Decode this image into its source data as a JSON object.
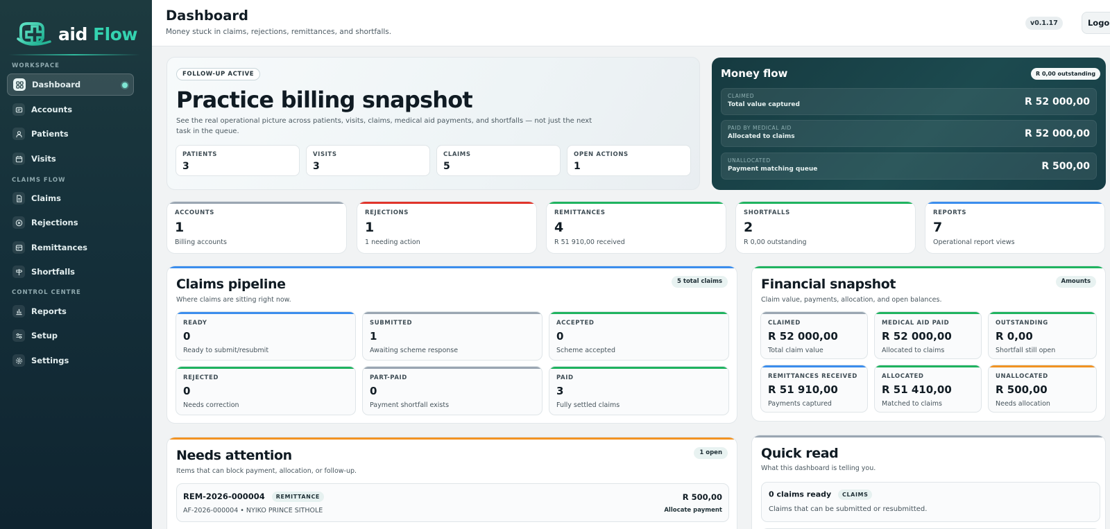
{
  "brand": {
    "word1": "aid",
    "word2": "Flow"
  },
  "sidebar": {
    "sections": {
      "workspace": "WORKSPACE",
      "claims_flow": "CLAIMS FLOW",
      "control_centre": "CONTROL CENTRE"
    },
    "items": [
      {
        "label": "Dashboard",
        "icon": "grid-icon",
        "active": true
      },
      {
        "label": "Accounts",
        "icon": "wallet-icon"
      },
      {
        "label": "Patients",
        "icon": "user-icon"
      },
      {
        "label": "Visits",
        "icon": "calendar-icon"
      },
      {
        "label": "Claims",
        "icon": "document-icon"
      },
      {
        "label": "Rejections",
        "icon": "x-circle-icon"
      },
      {
        "label": "Remittances",
        "icon": "receipt-icon"
      },
      {
        "label": "Shortfalls",
        "icon": "signpost-icon"
      },
      {
        "label": "Reports",
        "icon": "bar-chart-icon"
      },
      {
        "label": "Setup",
        "icon": "sliders-icon"
      },
      {
        "label": "Settings",
        "icon": "gear-icon"
      }
    ]
  },
  "header": {
    "title": "Dashboard",
    "subtitle": "Money stuck in claims, rejections, remittances, and shortfalls.",
    "version": "v0.1.17",
    "logout": "Logout"
  },
  "hero": {
    "badge": "FOLLOW-UP ACTIVE",
    "title": "Practice billing snapshot",
    "description": "See the real operational picture across patients, visits, claims, medical aid payments, and shortfalls — not just the next task in the queue.",
    "metrics": [
      {
        "label": "PATIENTS",
        "value": "3"
      },
      {
        "label": "VISITS",
        "value": "3"
      },
      {
        "label": "CLAIMS",
        "value": "5"
      },
      {
        "label": "OPEN ACTIONS",
        "value": "1"
      }
    ]
  },
  "money_flow": {
    "title": "Money flow",
    "outstanding": "R 0,00 outstanding",
    "rows": [
      {
        "label": "CLAIMED",
        "sub": "Total value captured",
        "value": "R 52 000,00"
      },
      {
        "label": "PAID BY MEDICAL AID",
        "sub": "Allocated to claims",
        "value": "R 52 000,00"
      },
      {
        "label": "UNALLOCATED",
        "sub": "Payment matching queue",
        "value": "R 500,00"
      }
    ]
  },
  "stats": [
    {
      "label": "ACCOUNTS",
      "value": "1",
      "sub": "Billing accounts",
      "color": "#9aa6b2"
    },
    {
      "label": "REJECTIONS",
      "value": "1",
      "sub": "1 needing action",
      "color": "#e0342b"
    },
    {
      "label": "REMITTANCES",
      "value": "4",
      "sub": "R 51 910,00 received",
      "color": "#1fb35f"
    },
    {
      "label": "SHORTFALLS",
      "value": "2",
      "sub": "R 0,00 outstanding",
      "color": "#1fb35f"
    },
    {
      "label": "REPORTS",
      "value": "7",
      "sub": "Operational report views",
      "color": "#3b8ded"
    }
  ],
  "pipeline": {
    "title": "Claims pipeline",
    "subtitle": "Where claims are sitting right now.",
    "badge": "5 total claims",
    "tiles": [
      {
        "label": "READY",
        "value": "0",
        "sub": "Ready to submit/resubmit",
        "color": "#3b8ded"
      },
      {
        "label": "SUBMITTED",
        "value": "1",
        "sub": "Awaiting scheme response",
        "color": "#9aa6b2"
      },
      {
        "label": "ACCEPTED",
        "value": "0",
        "sub": "Scheme accepted",
        "color": "#1fb35f"
      },
      {
        "label": "REJECTED",
        "value": "0",
        "sub": "Needs correction",
        "color": "#1fb35f"
      },
      {
        "label": "PART-PAID",
        "value": "0",
        "sub": "Payment shortfall exists",
        "color": "#9aa6b2"
      },
      {
        "label": "PAID",
        "value": "3",
        "sub": "Fully settled claims",
        "color": "#1fb35f"
      }
    ]
  },
  "financial": {
    "title": "Financial snapshot",
    "subtitle": "Claim value, payments, allocation, and open balances.",
    "badge": "Amounts",
    "tiles": [
      {
        "label": "CLAIMED",
        "value": "R 52 000,00",
        "sub": "Total claim value",
        "color": "#9aa6b2"
      },
      {
        "label": "MEDICAL AID PAID",
        "value": "R 52 000,00",
        "sub": "Allocated to claims",
        "color": "#1fb35f"
      },
      {
        "label": "OUTSTANDING",
        "value": "R 0,00",
        "sub": "Shortfall still open",
        "color": "#1fb35f"
      },
      {
        "label": "REMITTANCES RECEIVED",
        "value": "R 51 910,00",
        "sub": "Payments captured",
        "color": "#3b8ded"
      },
      {
        "label": "ALLOCATED",
        "value": "R 51 410,00",
        "sub": "Matched to claims",
        "color": "#1fb35f"
      },
      {
        "label": "UNALLOCATED",
        "value": "R 500,00",
        "sub": "Needs allocation",
        "color": "#f29322"
      }
    ]
  },
  "attention": {
    "title": "Needs attention",
    "subtitle": "Items that can block payment, allocation, or follow-up.",
    "badge": "1 open",
    "items": [
      {
        "ref": "REM-2026-000004",
        "tag": "REMITTANCE",
        "detail": "AF-2026-000004 • NYIKO PRINCE SITHOLE",
        "amount": "R 500,00",
        "action": "Allocate payment"
      }
    ]
  },
  "quick_read": {
    "title": "Quick read",
    "subtitle": "What this dashboard is telling you.",
    "items": [
      {
        "title": "0 claims ready",
        "tag": "CLAIMS",
        "detail": "Claims that can be submitted or resubmitted."
      }
    ]
  }
}
